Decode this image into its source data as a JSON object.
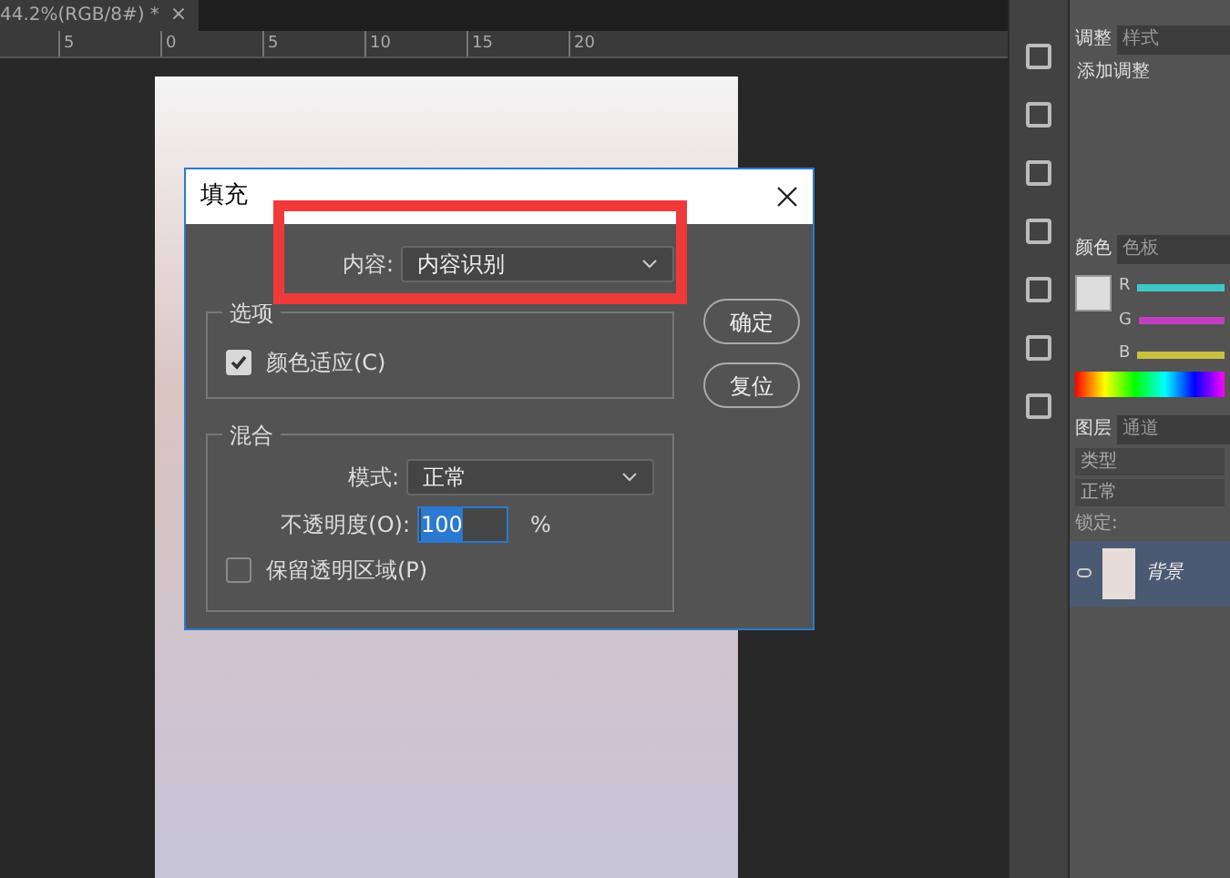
{
  "document_tab": {
    "title": "44.2%(RGB/8#) *",
    "close": "×"
  },
  "ruler": {
    "ticks": [
      "5",
      "0",
      "5",
      "10",
      "15",
      "20"
    ]
  },
  "dialog": {
    "title": "填充",
    "contents_label": "内容:",
    "contents_value": "内容识别",
    "buttons": [
      "确定",
      "复位"
    ],
    "options_group": "选项",
    "color_adapt": {
      "label": "颜色适应(C)",
      "checked": true
    },
    "blend_group": "混合",
    "mode_label": "模式:",
    "mode_value": "正常",
    "opacity_label": "不透明度(O):",
    "opacity_value": "100",
    "opacity_unit": "%",
    "preserve": {
      "label": "保留透明区域(P)",
      "checked": false
    }
  },
  "adjust_tabs": [
    {
      "label": "调整",
      "selected": true
    },
    {
      "label": "样式",
      "selected": false
    }
  ],
  "add_adjustment": "添加调整",
  "color_tabs": [
    {
      "label": "颜色",
      "selected": true
    },
    {
      "label": "色板",
      "selected": false
    }
  ],
  "channels": [
    {
      "label": "R",
      "color": "#3fc8c8"
    },
    {
      "label": "G",
      "color": "#c040c0"
    },
    {
      "label": "B",
      "color": "#c8c040"
    }
  ],
  "layer_tabs": [
    {
      "label": "图层",
      "selected": true
    },
    {
      "label": "通道",
      "selected": false
    }
  ],
  "layer_filter": "类型",
  "layer_blend": "正常",
  "lock_label": "锁定:",
  "layers": [
    {
      "name": "背景",
      "selected": true
    }
  ]
}
